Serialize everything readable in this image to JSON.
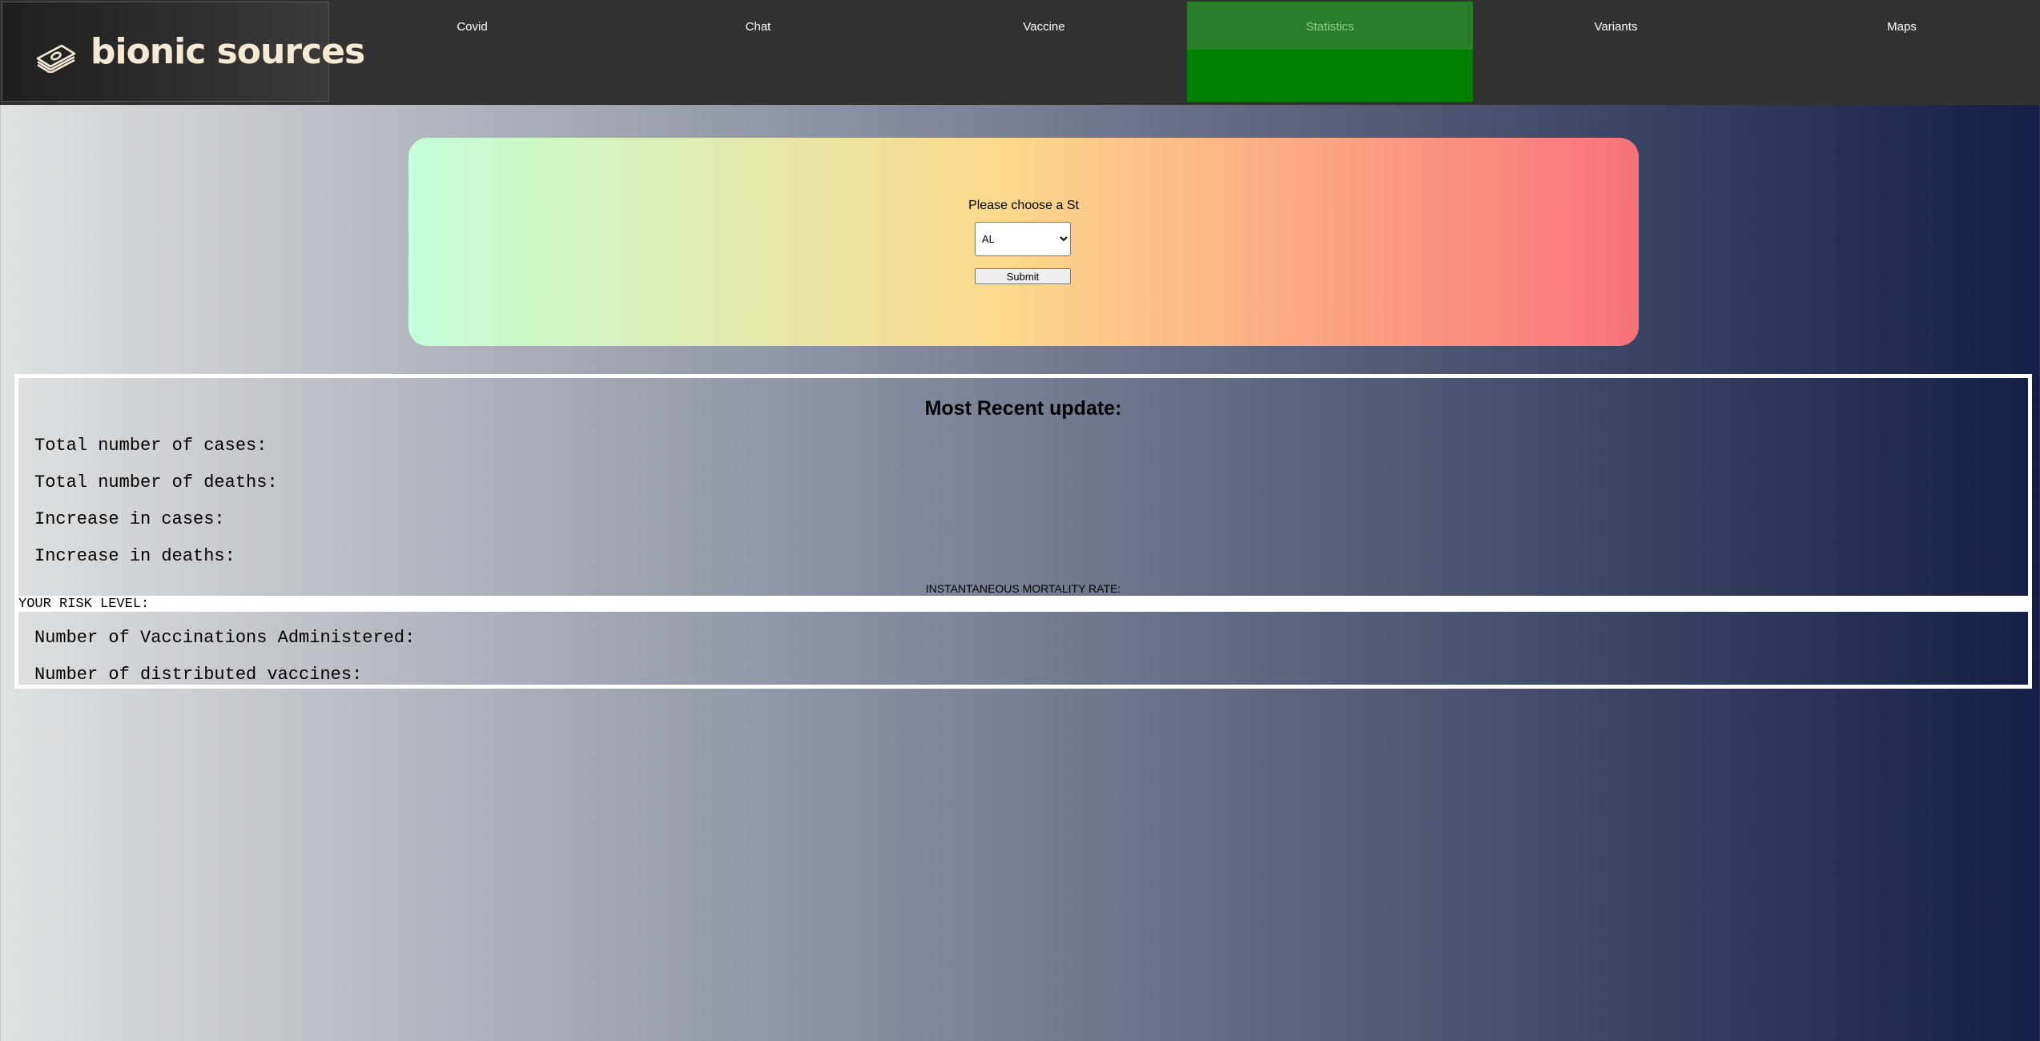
{
  "brand": {
    "name": "bionic sources",
    "icon": "money-stack-icon"
  },
  "nav": {
    "items": [
      {
        "label": "Covid"
      },
      {
        "label": "Chat"
      },
      {
        "label": "Vaccine"
      },
      {
        "label": "Statistics",
        "active": true
      },
      {
        "label": "Variants"
      },
      {
        "label": "Maps"
      }
    ]
  },
  "form": {
    "prompt": "Please choose a St",
    "state_selected": "AL",
    "submit_label": "Submit"
  },
  "stats": {
    "title": "Most Recent update:",
    "total_cases_label": "Total number of cases:",
    "total_deaths_label": "Total number of deaths:",
    "increase_cases_label": "Increase in cases:",
    "increase_deaths_label": "Increase in deaths:",
    "mortality_label": "INSTANTANEOUS MORTALITY RATE:",
    "risk_label": "YOUR RISK LEVEL:",
    "vaccinations_label": "Number of Vaccinations Administered:",
    "distributed_label": "Number of distributed vaccines:"
  },
  "colors": {
    "nav_background": "#333233",
    "nav_active": "#008000",
    "brand_text": "#f7ead4",
    "card_gradient_start": "#c3ffd8",
    "card_gradient_mid": "#fcd98c",
    "card_gradient_end": "#f9727a",
    "page_gradient_start": "#dfe2e3",
    "page_gradient_end": "#141f47"
  }
}
